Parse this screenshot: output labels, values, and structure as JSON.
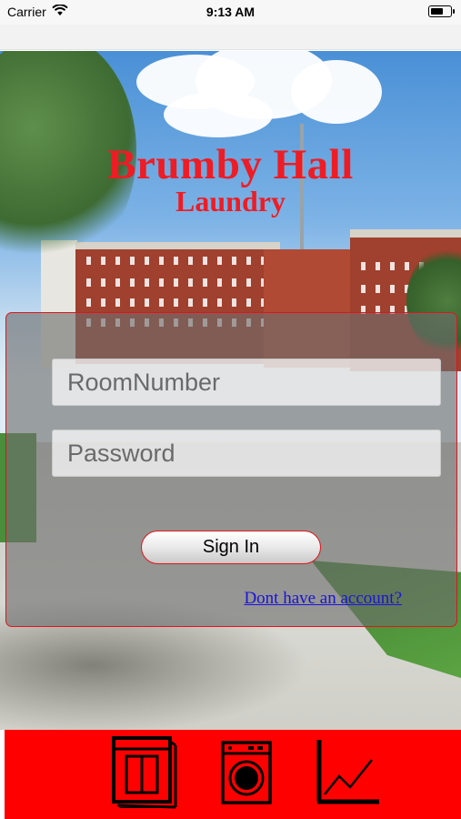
{
  "status_bar": {
    "carrier": "Carrier",
    "time": "9:13 AM",
    "icons": [
      "wifi-icon",
      "battery-icon"
    ]
  },
  "header": {
    "title": "Brumby Hall",
    "subtitle": "Laundry"
  },
  "login": {
    "room_placeholder": "RoomNumber",
    "password_placeholder": "Password",
    "room_value": "",
    "password_value": "",
    "sign_in_label": "Sign In",
    "signup_link": "Dont have an account?"
  },
  "tab_bar": {
    "tabs": [
      {
        "icon": "dryer-icon"
      },
      {
        "icon": "washing-machine-icon"
      },
      {
        "icon": "usage-chart-icon"
      }
    ]
  },
  "colors": {
    "accent_red": "#ff0000",
    "title_red": "#ee1c24",
    "link_blue": "#1a14d9"
  }
}
